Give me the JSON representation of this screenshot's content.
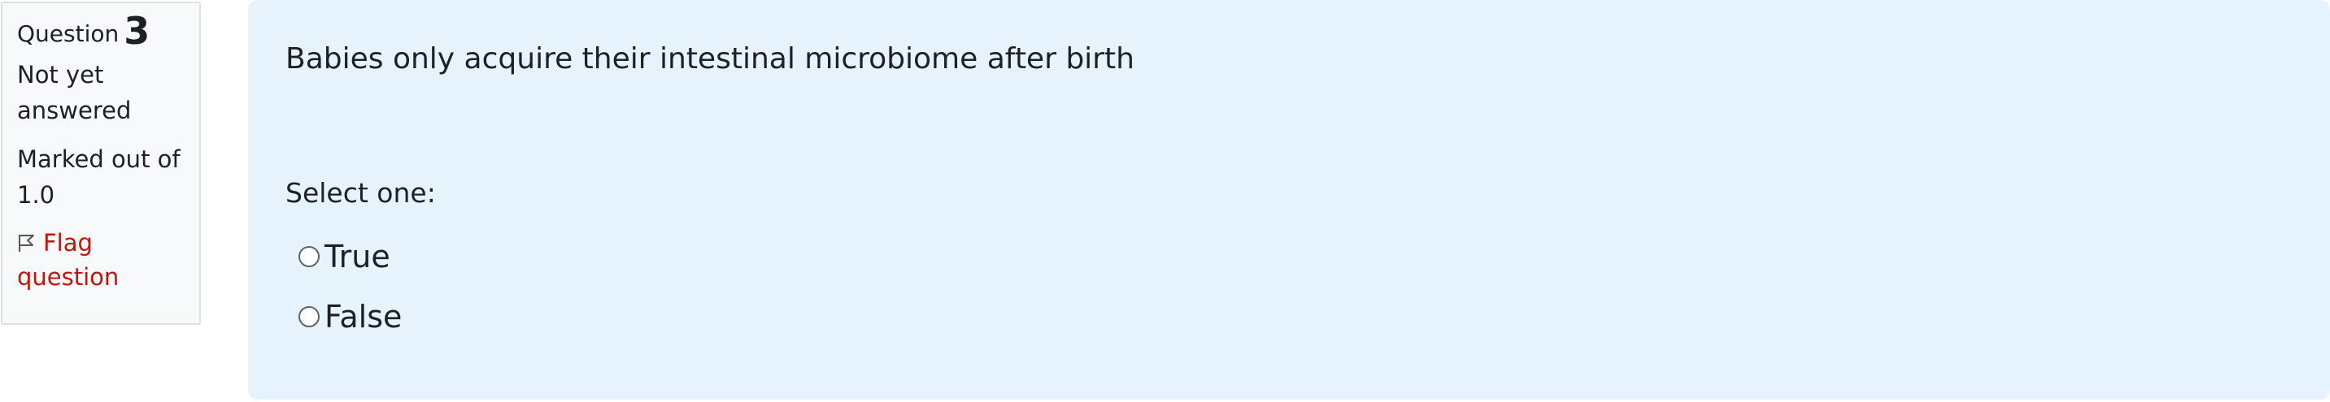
{
  "info": {
    "question_label": "Question",
    "question_number": "3",
    "state_line1": "Not yet",
    "state_line2": "answered",
    "grade_line1": "Marked out of",
    "grade_line2": "1.0",
    "flag_line1": "Flag",
    "flag_line2": "question",
    "flag_color": "#c0160d"
  },
  "question": {
    "text": "Babies only acquire their intestinal microbiome after birth",
    "prompt": "Select one:",
    "options": [
      {
        "label": "True",
        "selected": false
      },
      {
        "label": "False",
        "selected": false
      }
    ]
  },
  "colors": {
    "content_bg": "#e7f3fc",
    "info_bg": "#f8f9fa"
  }
}
